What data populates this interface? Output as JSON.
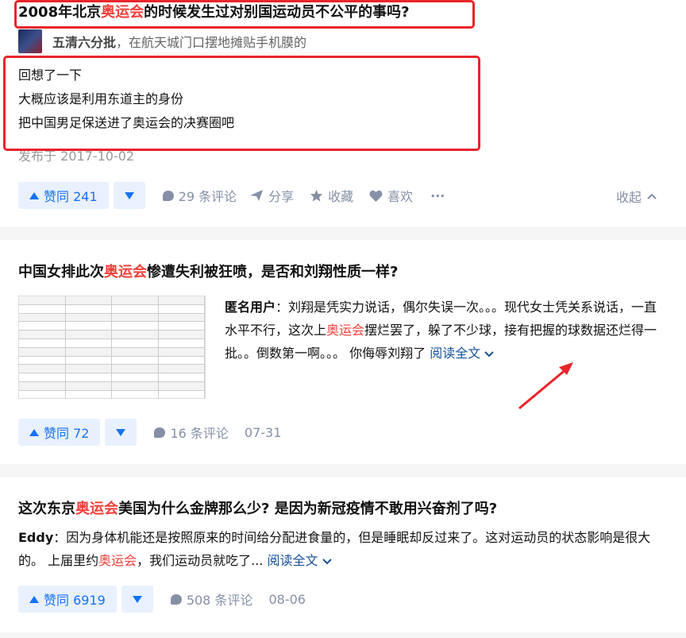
{
  "card1": {
    "title_pre": "2008年北京",
    "title_kw": "奥运会",
    "title_post": "的时候发生过对别国运动员不公平的事吗?",
    "author_name": "五清六分批",
    "author_bio": "，在航天城门口摆地摊贴手机膜的",
    "lines": [
      "回想了一下",
      "大概应该是利用东道主的身份",
      "把中国男足保送进了奥运会的决赛圈吧"
    ],
    "published": "发布于 2017-10-02",
    "vote_label": "赞同 241",
    "comments": "29 条评论",
    "share": "分享",
    "favorite": "收藏",
    "like": "喜欢",
    "more": "···",
    "collapse": "收起"
  },
  "card2": {
    "title_pre": "中国女排此次",
    "title_kw": "奥运会",
    "title_post": "惨遭失利被狂喷，是否和刘翔性质一样?",
    "author": "匿名用户",
    "excerpt_pre": "：刘翔是凭实力说话，偶尔失误一次。。。现代女士凭关系说话，一直水平不行，这次上",
    "excerpt_kw": "奥运会",
    "excerpt_post": "摆烂罢了，躲了不少球，接有把握的球数据还烂得一批。。倒数第一啊。。。 你侮辱刘翔了",
    "read_more": "阅读全文",
    "vote_label": "赞同 72",
    "comments": "16 条评论",
    "date": "07-31"
  },
  "card3": {
    "title_pre": "这次东京",
    "title_kw": "奥运会",
    "title_post": "美国为什么金牌那么少? 是因为新冠疫情不敢用兴奋剂了吗?",
    "author": "Eddy",
    "excerpt_pre": "：因为身体机能还是按照原来的时间给分配进食量的，但是睡眠却反过来了。这对运动员的状态影响是很大的。 上届里约",
    "excerpt_kw": "奥运会",
    "excerpt_post": "，我们运动员就吃了... ",
    "read_more": "阅读全文",
    "vote_label": "赞同 6919",
    "comments": "508 条评论",
    "date": "08-06"
  },
  "colors": {
    "accent": "#1772f6",
    "keyword": "#f1403c",
    "annotation": "#e8242a",
    "muted": "#8590a6"
  }
}
